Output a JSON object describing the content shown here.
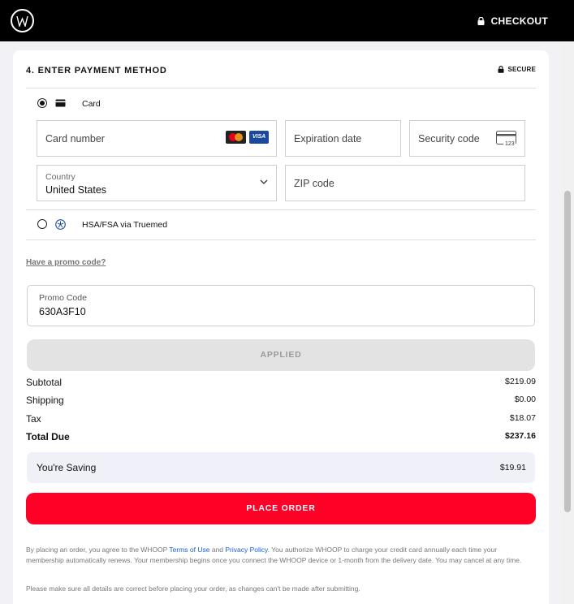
{
  "header": {
    "checkout_label": "CHECKOUT"
  },
  "payment": {
    "section_title": "4. ENTER PAYMENT METHOD",
    "secure_label": "SECURE",
    "card_option_label": "Card",
    "card_number_placeholder": "Card number",
    "card_brand_visa": "VISA",
    "expiration_placeholder": "Expiration date",
    "security_code_placeholder": "Security code",
    "country_label": "Country",
    "country_value": "United States",
    "zip_placeholder": "ZIP code",
    "hsa_option_label": "HSA/FSA via Truemed"
  },
  "promo": {
    "link_text": "Have a promo code?",
    "field_label": "Promo Code",
    "field_value": "630A3F10",
    "applied_label": "APPLIED"
  },
  "summary": {
    "subtotal_label": "Subtotal",
    "subtotal_value": "$219.09",
    "shipping_label": "Shipping",
    "shipping_value": "$0.00",
    "tax_label": "Tax",
    "tax_value": "$18.07",
    "total_label": "Total Due",
    "total_value": "$237.16",
    "saving_label": "You're Saving",
    "saving_value": "$19.91"
  },
  "actions": {
    "place_order_label": "PLACE ORDER"
  },
  "legal": {
    "part1": "By placing an order, you agree to the WHOOP ",
    "terms_link": "Terms of Use",
    "part2": " and ",
    "privacy_link": "Privacy Policy",
    "part3": ". You authorize WHOOP to charge your credit card annually each time your membership automatically renews. Your membership begins once you connect the WHOOP device or 1-month from the delivery date. You may cancel at any time.",
    "notice": "Please make sure all details are correct before placing your order, as changes can't be made after submitting."
  },
  "colors": {
    "accent": "#ff0026",
    "link": "#1b5fd6",
    "header_bg": "#000000"
  }
}
